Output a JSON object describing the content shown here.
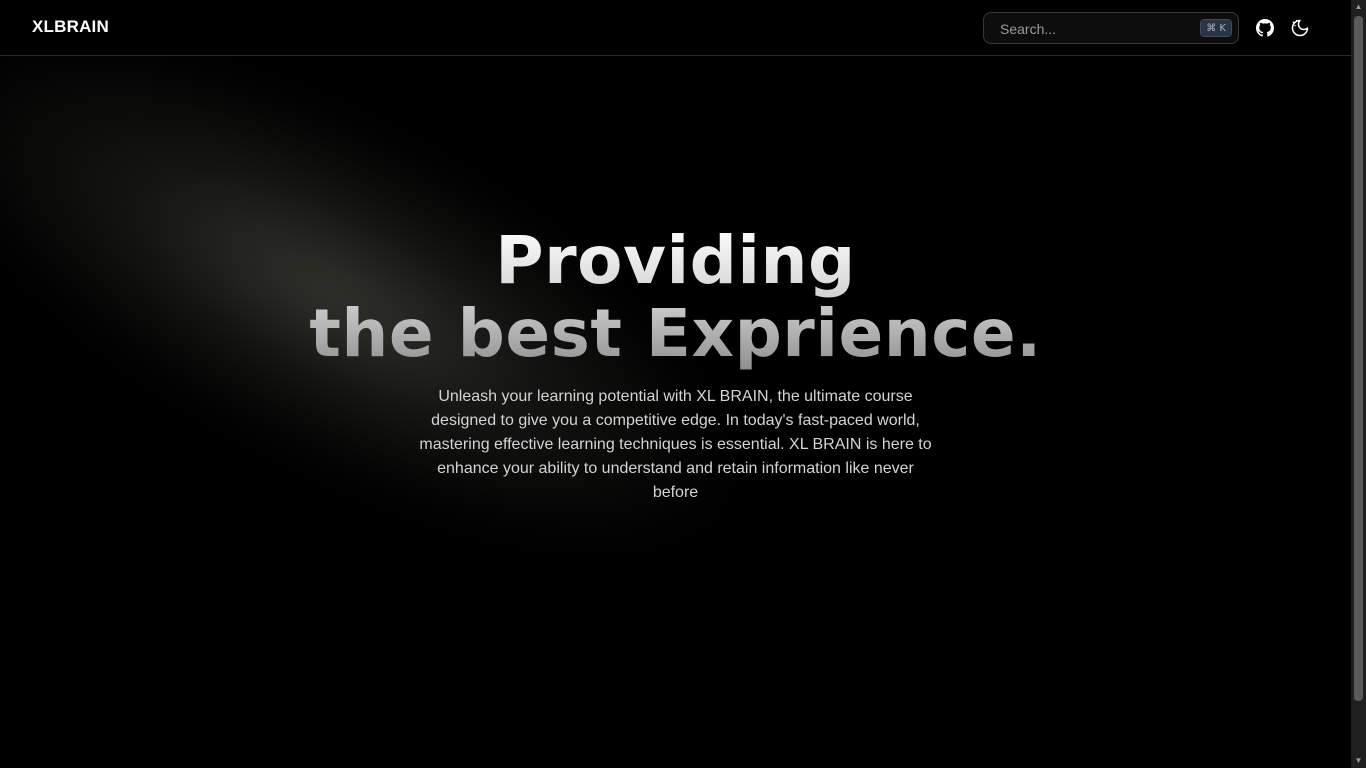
{
  "header": {
    "logo": "XLBRAIN",
    "search": {
      "placeholder": "Search...",
      "shortcut": "⌘ K"
    },
    "icons": [
      "github-icon",
      "theme-toggle-icon"
    ]
  },
  "hero": {
    "headline_line1": "Providing",
    "headline_line2": "the best Exprience.",
    "subtitle": "Unleash your learning potential with XL BRAIN, the ultimate course designed to give you a competitive edge. In today's fast-paced world, mastering effective learning techniques is essential. XL BRAIN is here to enhance your ability to understand and retain information like never before"
  },
  "colors": {
    "background": "#000000",
    "text": "#ffffff",
    "muted_text": "#d4d4d4",
    "border": "#2a2a2a"
  }
}
